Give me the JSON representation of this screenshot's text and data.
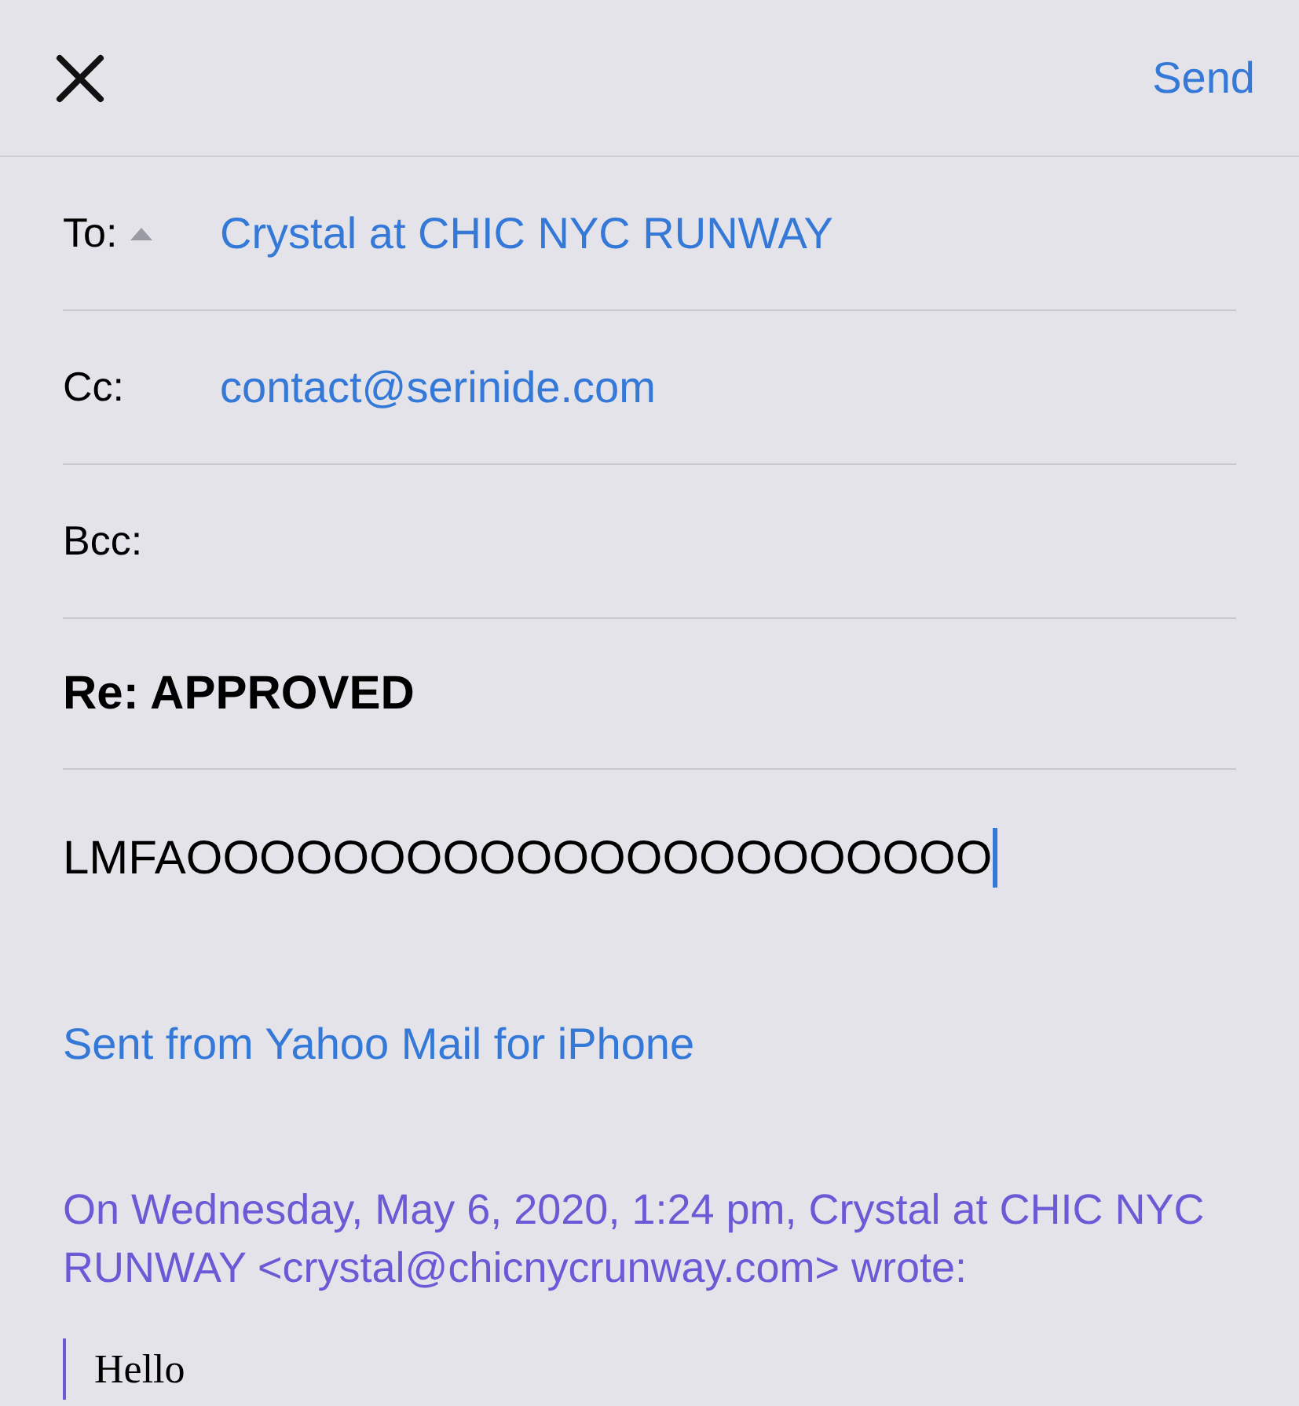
{
  "header": {
    "action": "Send"
  },
  "fields": [
    {
      "label": "To:",
      "value": "Crystal at CHIC NYC RUNWAY",
      "expanded": false
    },
    {
      "label": "Cc:",
      "value": "contact@serinide.com"
    },
    {
      "label": "Bcc:"
    }
  ],
  "subject": "Re: APPROVED",
  "body": "LMFAOOOOOOOOOOOOOOOOOOOOOO",
  "signature": "Sent from Yahoo Mail for iPhone",
  "quote_header": "On Wednesday, May 6, 2020, 1:24 pm, Crystal at CHIC NYC RUNWAY <crystal@chicnycrunway.com> wrote:",
  "quote_body": "Hello"
}
